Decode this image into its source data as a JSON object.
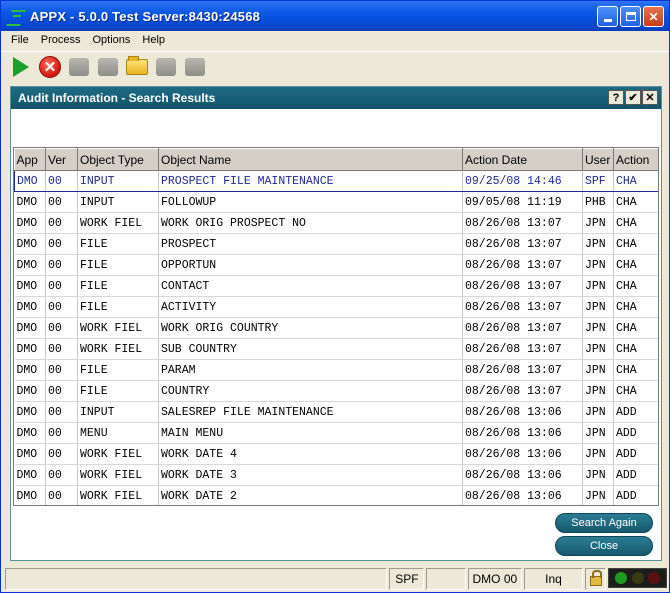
{
  "window": {
    "title": "APPX - 5.0.0 Test Server:8430:24568",
    "minimize": "_",
    "maximize": "□",
    "close": "✕"
  },
  "menu": [
    "File",
    "Process",
    "Options",
    "Help"
  ],
  "toolbar": [
    "play-icon",
    "stop-icon",
    "new-icon",
    "folder-icon",
    "open-folder-icon",
    "delete-icon",
    "delete-all-icon"
  ],
  "panel": {
    "title": "Audit Information - Search Results",
    "help": "?",
    "ok": "✔",
    "close": "✕"
  },
  "table": {
    "columns": [
      "App",
      "Ver",
      "Object Type",
      "Object Name",
      "Action Date",
      "User",
      "Action"
    ],
    "rows": [
      [
        "DMO",
        "00",
        "INPUT",
        "PROSPECT FILE MAINTENANCE",
        "09/25/08 14:46",
        "SPF",
        "CHA"
      ],
      [
        "DMO",
        "00",
        "INPUT",
        "FOLLOWUP",
        "09/05/08 11:19",
        "PHB",
        "CHA"
      ],
      [
        "DMO",
        "00",
        "WORK FIEL",
        "WORK ORIG PROSPECT NO",
        "08/26/08 13:07",
        "JPN",
        "CHA"
      ],
      [
        "DMO",
        "00",
        "FILE",
        "PROSPECT",
        "08/26/08 13:07",
        "JPN",
        "CHA"
      ],
      [
        "DMO",
        "00",
        "FILE",
        "OPPORTUN",
        "08/26/08 13:07",
        "JPN",
        "CHA"
      ],
      [
        "DMO",
        "00",
        "FILE",
        "CONTACT",
        "08/26/08 13:07",
        "JPN",
        "CHA"
      ],
      [
        "DMO",
        "00",
        "FILE",
        "ACTIVITY",
        "08/26/08 13:07",
        "JPN",
        "CHA"
      ],
      [
        "DMO",
        "00",
        "WORK FIEL",
        "WORK ORIG COUNTRY",
        "08/26/08 13:07",
        "JPN",
        "CHA"
      ],
      [
        "DMO",
        "00",
        "WORK FIEL",
        "SUB COUNTRY",
        "08/26/08 13:07",
        "JPN",
        "CHA"
      ],
      [
        "DMO",
        "00",
        "FILE",
        "PARAM",
        "08/26/08 13:07",
        "JPN",
        "CHA"
      ],
      [
        "DMO",
        "00",
        "FILE",
        "COUNTRY",
        "08/26/08 13:07",
        "JPN",
        "CHA"
      ],
      [
        "DMO",
        "00",
        "INPUT",
        "SALESREP FILE MAINTENANCE",
        "08/26/08 13:06",
        "JPN",
        "ADD"
      ],
      [
        "DMO",
        "00",
        "MENU",
        "MAIN MENU",
        "08/26/08 13:06",
        "JPN",
        "ADD"
      ],
      [
        "DMO",
        "00",
        "WORK FIEL",
        "WORK DATE 4",
        "08/26/08 13:06",
        "JPN",
        "ADD"
      ],
      [
        "DMO",
        "00",
        "WORK FIEL",
        "WORK DATE 3",
        "08/26/08 13:06",
        "JPN",
        "ADD"
      ],
      [
        "DMO",
        "00",
        "WORK FIEL",
        "WORK DATE 2",
        "08/26/08 13:06",
        "JPN",
        "ADD"
      ]
    ]
  },
  "buttons": {
    "search_again": "Search Again",
    "close": "Close"
  },
  "status": {
    "user": "SPF",
    "blank": "",
    "app_ver": "DMO 00",
    "mode": "Inq"
  },
  "colors": {
    "accent": "#1b6780",
    "light_red": "#5a1010",
    "light_yellow": "#3a3a10",
    "light_green": "#1e9a1e"
  }
}
